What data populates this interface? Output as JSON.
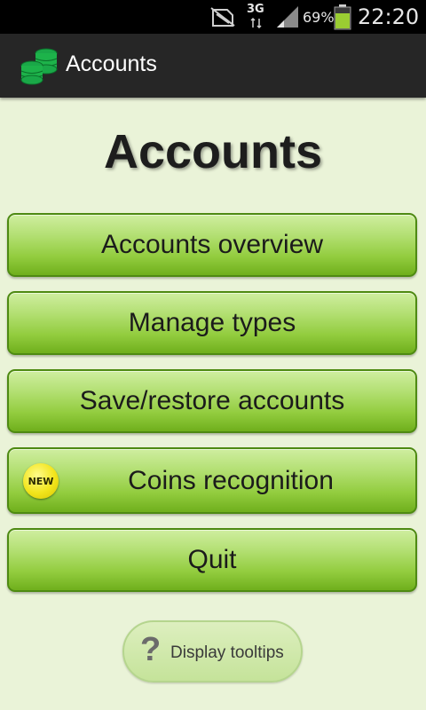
{
  "status_bar": {
    "network_type": "3G",
    "battery_percent": "69%",
    "time": "22:20",
    "icons": [
      "no-sim-icon",
      "data-transfer-icon",
      "signal-strength-icon",
      "battery-icon"
    ]
  },
  "action_bar": {
    "app_icon": "coin-stack-icon",
    "title": "Accounts"
  },
  "main": {
    "page_title": "Accounts",
    "buttons": [
      {
        "label": "Accounts overview"
      },
      {
        "label": "Manage types"
      },
      {
        "label": "Save/restore accounts"
      },
      {
        "label": "Coins recognition",
        "badge": "NEW"
      },
      {
        "label": "Quit"
      }
    ],
    "tooltips": {
      "icon": "question-mark-icon",
      "glyph": "?",
      "label": "Display tooltips"
    }
  },
  "colors": {
    "background": "#eaf3d8",
    "action_bar": "#262626",
    "button_green": "#92cc3e",
    "button_border": "#4e8a12",
    "badge_yellow": "#f2e51c",
    "app_icon_green": "#1db34a"
  }
}
